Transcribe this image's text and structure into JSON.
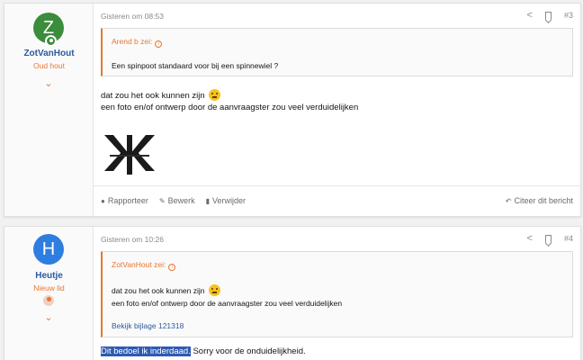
{
  "posts": [
    {
      "avatar_letter": "Z",
      "username": "ZotVanHout",
      "user_title": "Oud hout",
      "timestamp": "Gisteren om 08:53",
      "post_number": "#3",
      "quote": {
        "author": "Arend b zei:",
        "text": "Een spinpoot standaard voor bij een spinnewiel ?"
      },
      "body": [
        "dat zou het ook kunnen zijn",
        "een foto en/of ontwerp door de aanvraagster zou veel verduidelijken"
      ],
      "footer": {
        "report": "Rapporteer",
        "edit": "Bewerk",
        "delete": "Verwijder",
        "quote": "Citeer dit bericht"
      }
    },
    {
      "avatar_letter": "H",
      "username": "Heutje",
      "user_title": "Nieuw lid",
      "timestamp": "Gisteren om 10:26",
      "post_number": "#4",
      "quote": {
        "author": "ZotVanHout zei:",
        "line1": "dat zou het ook kunnen zijn",
        "line2": "een foto en/of ontwerp door de aanvraagster zou veel verduidelijken",
        "link": "Bekijk bijlage 121318"
      },
      "body_highlight": "Dit bedoel ik inderdaad.",
      "body_rest": " Sorry voor de onduidelijkheid."
    }
  ],
  "colors": {
    "accent": "#e8772e",
    "link": "#2b5a9e",
    "avatar_z": "#3b8c3b",
    "avatar_h": "#2e7de0",
    "selection": "#2e5ab2"
  }
}
